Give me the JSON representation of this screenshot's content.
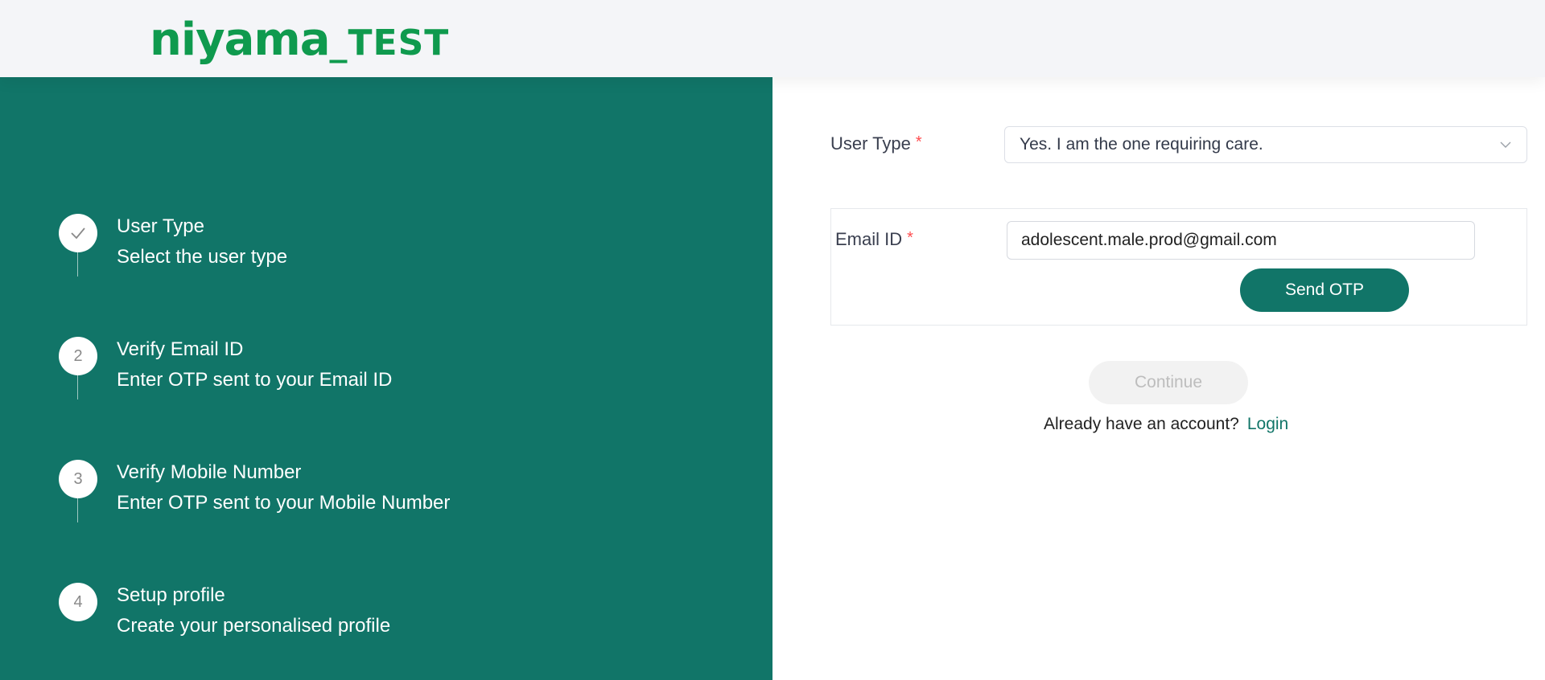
{
  "header": {
    "logo_text": "niyama",
    "logo_suffix": "_TEST",
    "brand_color": "#0f9a4e"
  },
  "colors": {
    "primary": "#117568",
    "required": "#ff4d4f"
  },
  "steps": [
    {
      "marker": "",
      "icon": "checkmark-icon",
      "title": "User Type",
      "description": "Select the user type",
      "status": "completed"
    },
    {
      "marker": "2",
      "title": "Verify Email ID",
      "description": "Enter OTP sent to your Email ID",
      "status": "pending"
    },
    {
      "marker": "3",
      "title": "Verify Mobile Number",
      "description": "Enter OTP sent to your Mobile Number",
      "status": "pending"
    },
    {
      "marker": "4",
      "title": "Setup profile",
      "description": "Create your personalised profile",
      "status": "pending"
    }
  ],
  "form": {
    "user_type_label": "User Type",
    "required_mark": "*",
    "user_type_value": "Yes. I am the one requiring care.",
    "email_label": "Email ID",
    "email_value": "adolescent.male.prod@gmail.com",
    "send_otp_label": "Send OTP",
    "continue_label": "Continue",
    "have_account_text": "Already have an account?",
    "login_label": "Login"
  }
}
